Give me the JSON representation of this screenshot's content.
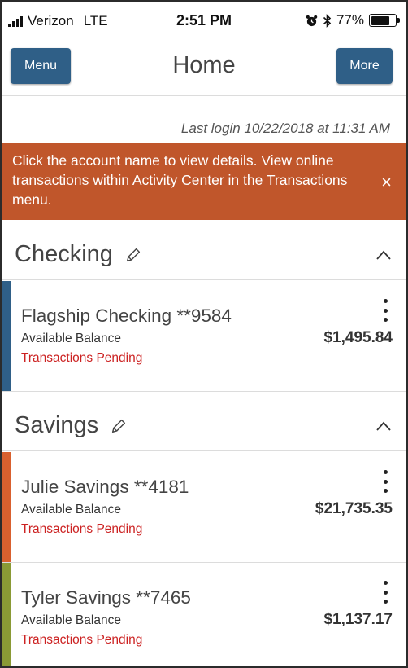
{
  "status_bar": {
    "carrier": "Verizon",
    "network": "LTE",
    "time": "2:51 PM",
    "battery": "77%",
    "battery_level": 0.77
  },
  "header": {
    "menu_label": "Menu",
    "title": "Home",
    "more_label": "More"
  },
  "last_login": "Last login 10/22/2018 at 11:31 AM",
  "banner": {
    "text": "Click the account name to view details. View online transactions within Activity Center in the Transactions menu.",
    "close": "×",
    "color": "#c0562b"
  },
  "sections": [
    {
      "title": "Checking",
      "accounts": [
        {
          "name": "Flagship Checking **9584",
          "balance_label": "Available Balance",
          "status": "Transactions Pending",
          "balance": "$1,495.84",
          "color": "#2f5f87"
        }
      ]
    },
    {
      "title": "Savings",
      "accounts": [
        {
          "name": "Julie Savings **4181",
          "balance_label": "Available Balance",
          "status": "Transactions Pending",
          "balance": "$21,735.35",
          "color": "#d9602e"
        },
        {
          "name": "Tyler Savings **7465",
          "balance_label": "Available Balance",
          "status": "Transactions Pending",
          "balance": "$1,137.17",
          "color": "#8a9a35"
        }
      ]
    }
  ],
  "colors": {
    "button_bg": "#2f5f87",
    "pending_text": "#cc2222"
  },
  "icons": {
    "edit": "pencil-icon",
    "collapse": "chevron-up-icon",
    "options": "kebab-menu-icon",
    "close": "close-icon"
  }
}
